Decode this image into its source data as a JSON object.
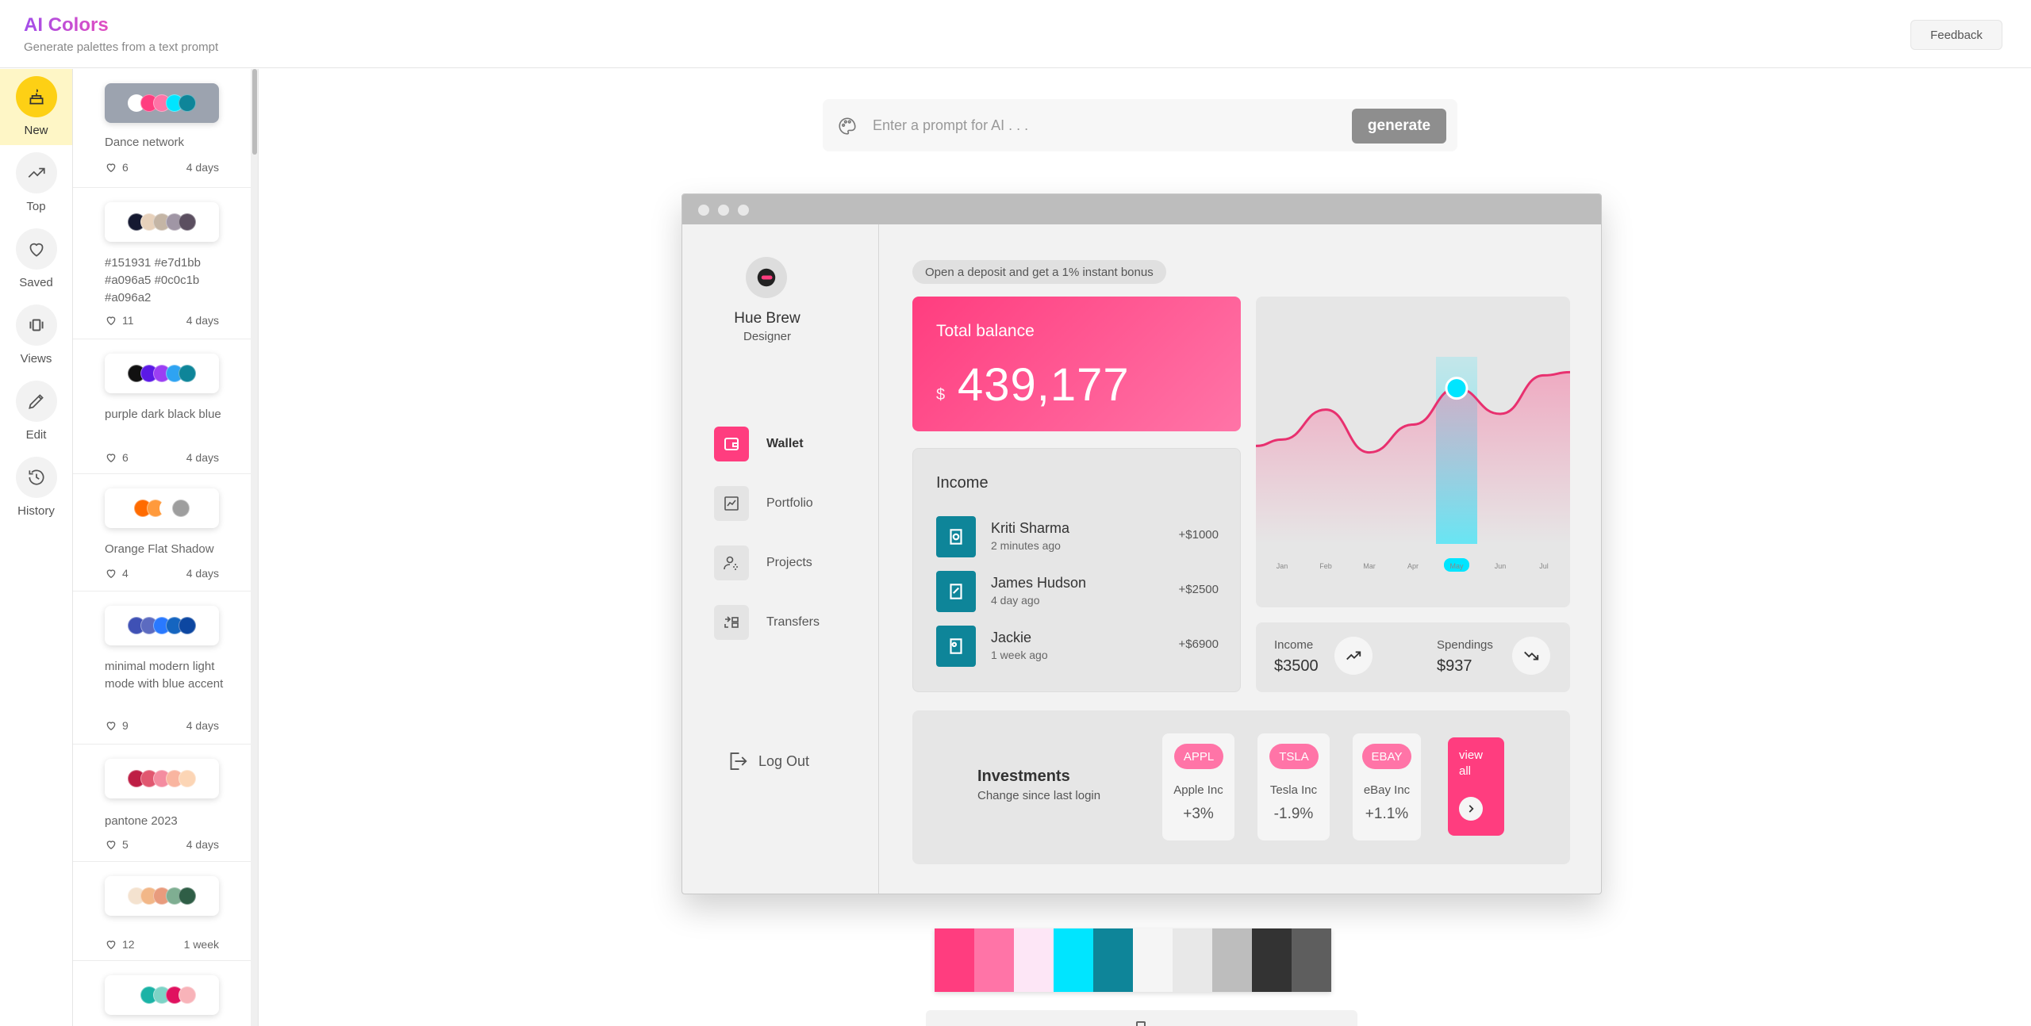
{
  "app": {
    "title": "AI Colors",
    "subtitle": "Generate palettes from a text prompt",
    "feedback_label": "Feedback"
  },
  "sidebar": {
    "items": [
      {
        "label": "New",
        "icon": "cake-icon",
        "active": true
      },
      {
        "label": "Top",
        "icon": "trending-up-icon"
      },
      {
        "label": "Saved",
        "icon": "heart-icon"
      },
      {
        "label": "Views",
        "icon": "carousel-icon"
      },
      {
        "label": "Edit",
        "icon": "pencil-icon"
      },
      {
        "label": "History",
        "icon": "history-icon"
      }
    ]
  },
  "palettes": [
    {
      "name": "Dance network",
      "likes": "6",
      "age": "4 days",
      "colors": [
        "#ffffff",
        "#ff3d7f",
        "#ff74a7",
        "#00e5ff",
        "#0e8599"
      ],
      "selected": true
    },
    {
      "name": "#151931 #e7d1bb #a096a5 #0c0c1b #a096a2",
      "likes": "11",
      "age": "4 days",
      "colors": [
        "#151931",
        "#e7d1bb",
        "#c4b5a5",
        "#a096a5",
        "#5b4f60"
      ]
    },
    {
      "name": "purple dark black blue",
      "likes": "6",
      "age": "4 days",
      "colors": [
        "#111111",
        "#5b19e6",
        "#9b3ff3",
        "#2ea3f2",
        "#0e8599"
      ]
    },
    {
      "name": "Orange Flat Shadow",
      "likes": "4",
      "age": "4 days",
      "colors": [
        "#ff6b00",
        "#ff9a3c",
        "#ffffff",
        "#9e9e9e"
      ]
    },
    {
      "name": "minimal modern light mode with blue accent",
      "likes": "9",
      "age": "4 days",
      "colors": [
        "#3f51b5",
        "#5c6bc0",
        "#2979ff",
        "#1565c0",
        "#0d47a1"
      ]
    },
    {
      "name": "pantone 2023",
      "likes": "5",
      "age": "4 days",
      "colors": [
        "#be1e45",
        "#e15770",
        "#f48ca0",
        "#f9b5a0",
        "#fcd5b5"
      ]
    },
    {
      "name": "",
      "likes": "12",
      "age": "1 week",
      "colors": [
        "#f4e2cf",
        "#f2b788",
        "#e89b7d",
        "#7fae92",
        "#2f5e46"
      ]
    },
    {
      "name": "",
      "likes": "",
      "age": "",
      "colors": [
        "#ffffff",
        "#1ab3a6",
        "#7dd3c6",
        "#e0115f",
        "#f8b3b9"
      ]
    }
  ],
  "prompt": {
    "placeholder": "Enter a prompt for AI . . .",
    "value": "",
    "generate_label": "generate"
  },
  "mockup": {
    "user_name": "Hue Brew",
    "user_role": "Designer",
    "nav": [
      {
        "label": "Wallet",
        "active": true
      },
      {
        "label": "Portfolio"
      },
      {
        "label": "Projects"
      },
      {
        "label": "Transfers"
      }
    ],
    "logout_label": "Log Out",
    "promo": "Open a deposit and get a 1% instant bonus",
    "balance": {
      "label": "Total balance",
      "currency": "$",
      "amount": "439,177"
    },
    "income": {
      "title": "Income",
      "rows": [
        {
          "name": "Kriti Sharma",
          "time": "2 minutes ago",
          "amount": "+$1000"
        },
        {
          "name": "James Hudson",
          "time": "4 day ago",
          "amount": "+$2500"
        },
        {
          "name": "Jackie",
          "time": "1 week ago",
          "amount": "+$6900"
        }
      ]
    },
    "chart_data": {
      "type": "area",
      "categories": [
        "Jan",
        "Feb",
        "Mar",
        "Apr",
        "May",
        "Jun",
        "Jul"
      ],
      "values": [
        48,
        62,
        42,
        55,
        72,
        60,
        78
      ],
      "highlight": "May"
    },
    "stats": {
      "income_label": "Income",
      "income_value": "$3500",
      "spend_label": "Spendings",
      "spend_value": "$937"
    },
    "investments": {
      "title": "Investments",
      "subtitle": "Change since last login",
      "stocks": [
        {
          "ticker": "APPL",
          "name": "Apple Inc",
          "change": "+3%"
        },
        {
          "ticker": "TSLA",
          "name": "Tesla Inc",
          "change": "-1.9%"
        },
        {
          "ticker": "EBAY",
          "name": "eBay Inc",
          "change": "+1.1%"
        }
      ],
      "view_all_label": "view all"
    }
  },
  "swatches": [
    "#ff3d7f",
    "#ff74a7",
    "#fde6f6",
    "#00e5ff",
    "#0e8599",
    "#f5f5f5",
    "#e8e8e8",
    "#bdbdbd",
    "#333333",
    "#5e5e5e"
  ],
  "colors": {
    "accent": "#ff3d7f",
    "teal": "#0e8599",
    "cyan": "#00e5ff",
    "yellow": "#fdd015"
  }
}
